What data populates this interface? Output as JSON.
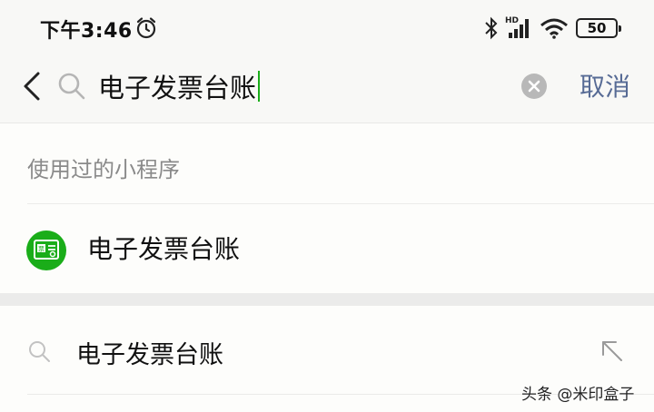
{
  "status_bar": {
    "time": "下午3:46",
    "battery": "50",
    "network_label": "HD"
  },
  "search": {
    "query": "电子发票台账",
    "cancel_label": "取消"
  },
  "section": {
    "title": "使用过的小程序"
  },
  "mini_program": {
    "name": "电子发票台账",
    "icon_glyph": "票",
    "icon_color": "#1aad19"
  },
  "suggestion": {
    "text": "电子发票台账"
  },
  "watermark": "头条 @米印盒子",
  "colors": {
    "accent_green": "#1aad19",
    "link_blue": "#576b95",
    "muted_text": "#8a8a8a"
  }
}
